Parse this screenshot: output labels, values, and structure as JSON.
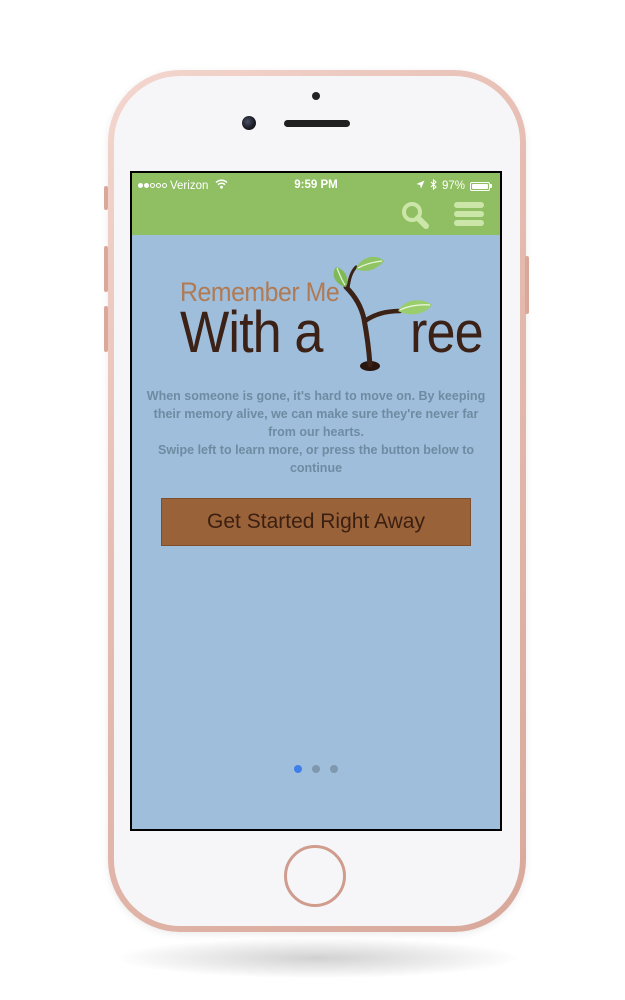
{
  "status_bar": {
    "carrier": "Verizon",
    "time": "9:59 PM",
    "battery_percent": "97%",
    "battery_level": 0.97,
    "signal_bars_filled": 2,
    "signal_bars_total": 5
  },
  "app_bar": {
    "color": "#8fbf62",
    "search_icon": "search-icon",
    "menu_icon": "hamburger-menu-icon"
  },
  "logo": {
    "line1": "Remember Me",
    "line2_part1": "With a",
    "line2_part2": "ree"
  },
  "intro": {
    "line1": "When someone is gone, it's hard to move on. By keeping their memory alive, we can make sure they're never far from our hearts.",
    "line2": "Swipe left to learn more, or press the button below to continue"
  },
  "cta": {
    "label": "Get Started Right Away",
    "color": "#9a6238"
  },
  "pager": {
    "total": 3,
    "active_index": 0,
    "active_color": "#3f7fea"
  },
  "colors": {
    "screen_background": "#9ebedc",
    "header_green": "#8fbf62",
    "logo_brown": "#3c2116",
    "logo_tan": "#b07a54"
  }
}
